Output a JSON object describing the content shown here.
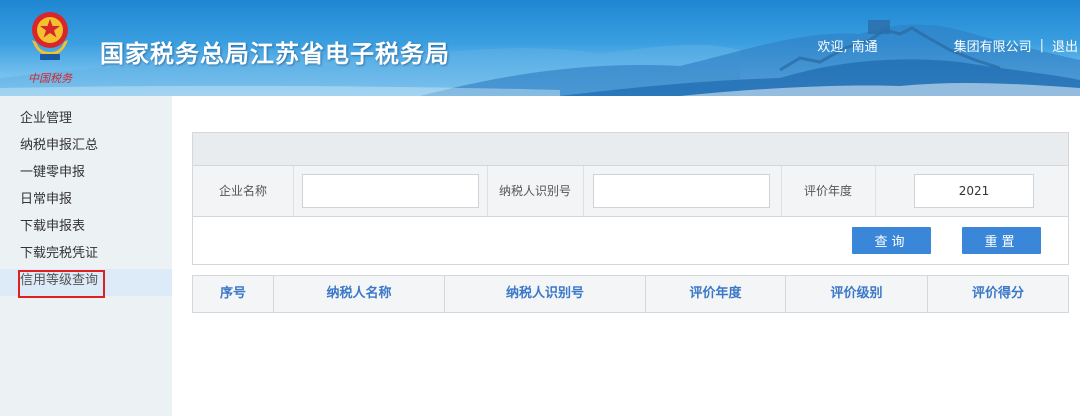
{
  "header": {
    "brand_script": "中国税务",
    "site_title": "国家税务总局江苏省电子税务局",
    "welcome": "欢迎, 南通",
    "company": "集团有限公司",
    "separator": "|",
    "logout": "退出"
  },
  "sidebar": {
    "items": [
      {
        "label": "企业管理"
      },
      {
        "label": "纳税申报汇总"
      },
      {
        "label": "一键零申报"
      },
      {
        "label": "日常申报"
      },
      {
        "label": "下载申报表"
      },
      {
        "label": "下载完税凭证"
      },
      {
        "label": "信用等级查询"
      }
    ]
  },
  "search": {
    "company_name_label": "企业名称",
    "company_name_value": "",
    "taxpayer_id_label": "纳税人识别号",
    "taxpayer_id_value": "",
    "eval_year_label": "评价年度",
    "eval_year_value": "2021",
    "query_button": "查询",
    "reset_button": "重置"
  },
  "table": {
    "columns": [
      "序号",
      "纳税人名称",
      "纳税人识别号",
      "评价年度",
      "评价级别",
      "评价得分"
    ]
  },
  "colors": {
    "accent": "#3a86d8",
    "header_blue": "#1f86d2",
    "highlight_border": "#e02020",
    "column_text": "#3b78c8"
  }
}
